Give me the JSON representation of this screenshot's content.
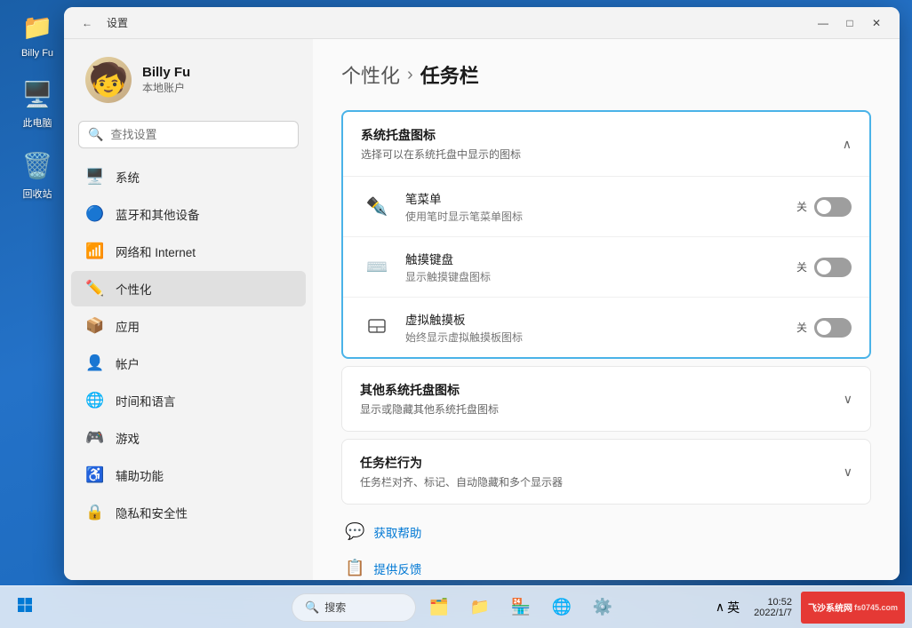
{
  "desktop": {
    "icons": [
      {
        "id": "user",
        "label": "Billy Fu",
        "emoji": "👤"
      },
      {
        "id": "computer",
        "label": "此电脑",
        "emoji": "🖥️"
      },
      {
        "id": "recycle",
        "label": "回收站",
        "emoji": "🗑️"
      }
    ]
  },
  "taskbar": {
    "search_placeholder": "搜索",
    "tray_text": "∧ 英",
    "fs_logo": "飞沙系统网",
    "fs_sub": "fs0745.com"
  },
  "window": {
    "title": "设置",
    "min_label": "—",
    "max_label": "□",
    "close_label": "✕"
  },
  "sidebar": {
    "user_name": "Billy Fu",
    "user_type": "本地账户",
    "search_placeholder": "查找设置",
    "nav_items": [
      {
        "id": "system",
        "label": "系统",
        "icon": "🖥️"
      },
      {
        "id": "bluetooth",
        "label": "蓝牙和其他设备",
        "icon": "🔵"
      },
      {
        "id": "network",
        "label": "网络和 Internet",
        "icon": "📶"
      },
      {
        "id": "personalize",
        "label": "个性化",
        "icon": "✏️",
        "active": true
      },
      {
        "id": "apps",
        "label": "应用",
        "icon": "📦"
      },
      {
        "id": "accounts",
        "label": "帐户",
        "icon": "👤"
      },
      {
        "id": "time",
        "label": "时间和语言",
        "icon": "🌐"
      },
      {
        "id": "games",
        "label": "游戏",
        "icon": "🎮"
      },
      {
        "id": "accessibility",
        "label": "辅助功能",
        "icon": "♿"
      },
      {
        "id": "privacy",
        "label": "隐私和安全性",
        "icon": "🔒"
      }
    ]
  },
  "main": {
    "breadcrumb_parent": "个性化",
    "breadcrumb_separator": "›",
    "breadcrumb_current": "任务栏",
    "sections": [
      {
        "id": "system-tray-icons",
        "title": "系统托盘图标",
        "desc": "选择可以在系统托盘中显示的图标",
        "expanded": true,
        "chevron": "∧",
        "items": [
          {
            "id": "pen-menu",
            "icon_char": "✒",
            "title": "笔菜单",
            "desc": "使用笔时显示笔菜单图标",
            "toggle_label": "关",
            "toggle_on": false
          },
          {
            "id": "touch-keyboard",
            "icon_char": "⌨",
            "title": "触摸键盘",
            "desc": "显示触摸键盘图标",
            "toggle_label": "关",
            "toggle_on": false
          },
          {
            "id": "virtual-touchpad",
            "icon_char": "⬜",
            "title": "虚拟触摸板",
            "desc": "始终显示虚拟触摸板图标",
            "toggle_label": "关",
            "toggle_on": false
          }
        ]
      },
      {
        "id": "other-tray-icons",
        "title": "其他系统托盘图标",
        "desc": "显示或隐藏其他系统托盘图标",
        "expanded": false,
        "chevron": "∨"
      },
      {
        "id": "taskbar-behavior",
        "title": "任务栏行为",
        "desc": "任务栏对齐、标记、自动隐藏和多个显示器",
        "expanded": false,
        "chevron": "∨"
      }
    ],
    "help_label": "获取帮助",
    "provide_label": "提供反馈"
  }
}
